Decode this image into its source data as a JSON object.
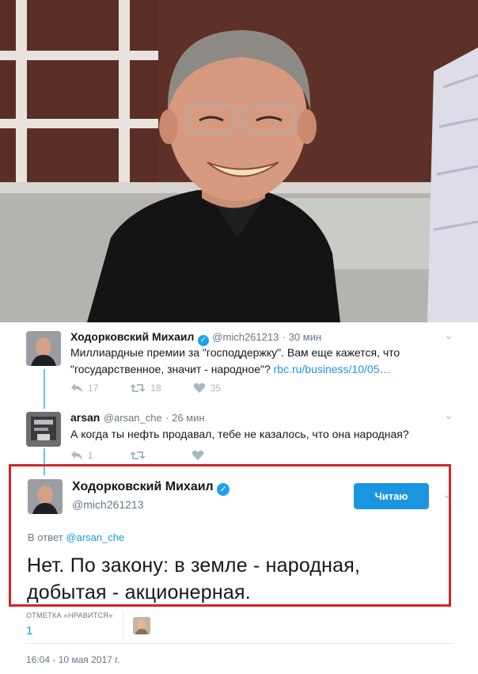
{
  "tweets": [
    {
      "name": "Ходорковский Михаил",
      "handle": "@mich261213",
      "time": "· 30 мин",
      "text_line1": "Миллиардные премии за \"господдержку\". Вам еще кажется, что",
      "text_line2": "\"государственное, значит - народное\"?",
      "link": "rbc.ru/business/10/05…",
      "replies": "17",
      "retweets": "18",
      "likes": "35"
    },
    {
      "name": "arsan",
      "handle": "@arsan_che",
      "time": "· 26 мин",
      "text": "А когда ты нефть продавал, тебе не казалось, что она народная?",
      "replies": "1",
      "retweets": "",
      "likes": ""
    }
  ],
  "main_tweet": {
    "name": "Ходорковский Михаил",
    "handle": "@mich261213",
    "follow_label": "Читаю",
    "reply_prefix": "В ответ",
    "reply_handle": "@arsan_che",
    "text": "Нет. По закону: в земле - народная, добытая - акционерная.",
    "likes_label": "ОТМЕТКА «НРАВИТСЯ»",
    "likes_count": "1",
    "timestamp": "16:04 - 10 мая 2017 г."
  },
  "colors": {
    "accent": "#1b95e0",
    "thread_line": "#5ec6ee",
    "highlight_border": "#d6232a",
    "muted": "#657786"
  },
  "icons": {
    "verified": "verified-badge-icon",
    "reply": "reply-icon",
    "retweet": "retweet-icon",
    "like": "heart-icon",
    "menu": "chevron-down-icon"
  }
}
